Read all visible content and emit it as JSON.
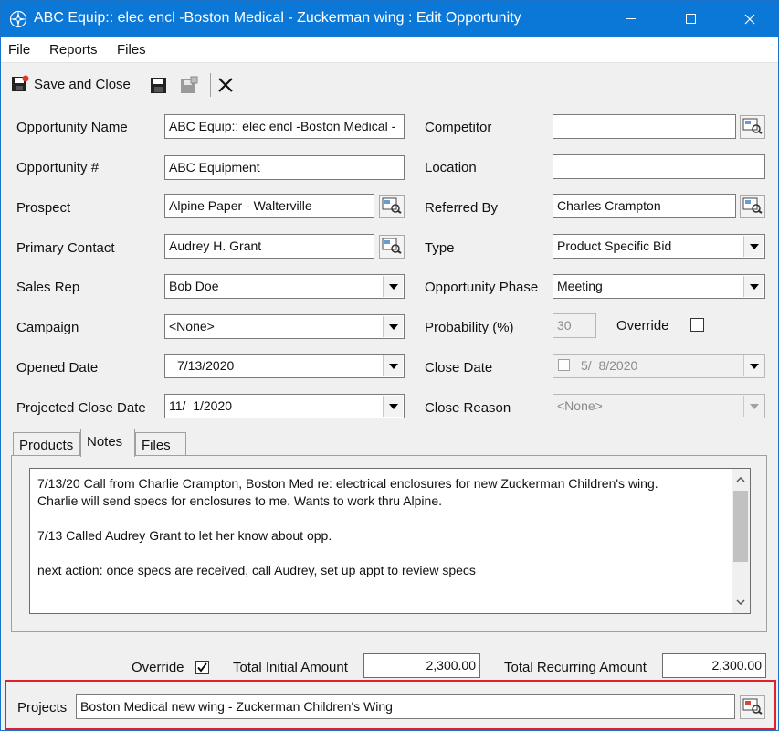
{
  "window": {
    "title": "ABC Equip:: elec encl -Boston Medical - Zuckerman wing : Edit Opportunity",
    "app_icon": "compass-rose-icon"
  },
  "menu": [
    "File",
    "Reports",
    "Files"
  ],
  "toolbar": {
    "save_close_label": "Save and Close",
    "save_icon": "floppy-disk-icon",
    "save_new_icon": "floppy-disk-new-icon",
    "delete_icon": "x-icon"
  },
  "form": {
    "opportunity_name": {
      "label": "Opportunity Name",
      "value": "ABC Equip:: elec encl -Boston Medical -"
    },
    "opportunity_num": {
      "label": "Opportunity #",
      "value": "ABC Equipment"
    },
    "prospect": {
      "label": "Prospect",
      "value": "Alpine Paper - Walterville"
    },
    "primary_contact": {
      "label": "Primary Contact",
      "value": "Audrey H. Grant"
    },
    "sales_rep": {
      "label": "Sales Rep",
      "value": "Bob Doe"
    },
    "campaign": {
      "label": "Campaign",
      "value": "<None>"
    },
    "opened_date": {
      "label": "Opened Date",
      "value": "7/13/2020"
    },
    "projected_close_date": {
      "label": "Projected Close Date",
      "value": "11/  1/2020"
    },
    "competitor": {
      "label": "Competitor",
      "value": ""
    },
    "location": {
      "label": "Location",
      "value": ""
    },
    "referred_by": {
      "label": "Referred By",
      "value": "Charles Crampton"
    },
    "type": {
      "label": "Type",
      "value": "Product Specific Bid"
    },
    "phase": {
      "label": "Opportunity Phase",
      "value": "Meeting"
    },
    "probability": {
      "label": "Probability (%)",
      "value": "30"
    },
    "override": {
      "label": "Override",
      "checked": false
    },
    "close_date": {
      "label": "Close Date",
      "value": "5/  8/2020",
      "checked": false
    },
    "close_reason": {
      "label": "Close Reason",
      "value": "<None>"
    }
  },
  "tabs": [
    {
      "label": "Products",
      "active": false
    },
    {
      "label": "Notes",
      "active": true
    },
    {
      "label": "Files",
      "active": false
    }
  ],
  "notes": {
    "line1": "7/13/20  Call from Charlie Crampton, Boston Med re: electrical enclosures for new Zuckerman Children's wing.",
    "line2": "Charlie will send specs for enclosures to me.  Wants to work thru Alpine.",
    "line3": "7/13  Called Audrey Grant to let her know about opp.",
    "line4": "next action:  once specs are received, call Audrey, set up appt to review specs"
  },
  "totals": {
    "override_label": "Override",
    "override_checked": true,
    "initial_label": "Total Initial Amount",
    "initial_value": "2,300.00",
    "recurring_label": "Total Recurring Amount",
    "recurring_value": "2,300.00"
  },
  "projects": {
    "label": "Projects",
    "value": "Boston Medical new wing - Zuckerman Children's Wing"
  },
  "colors": {
    "titlebar": "#0b78d7",
    "highlight": "#e0202a"
  }
}
